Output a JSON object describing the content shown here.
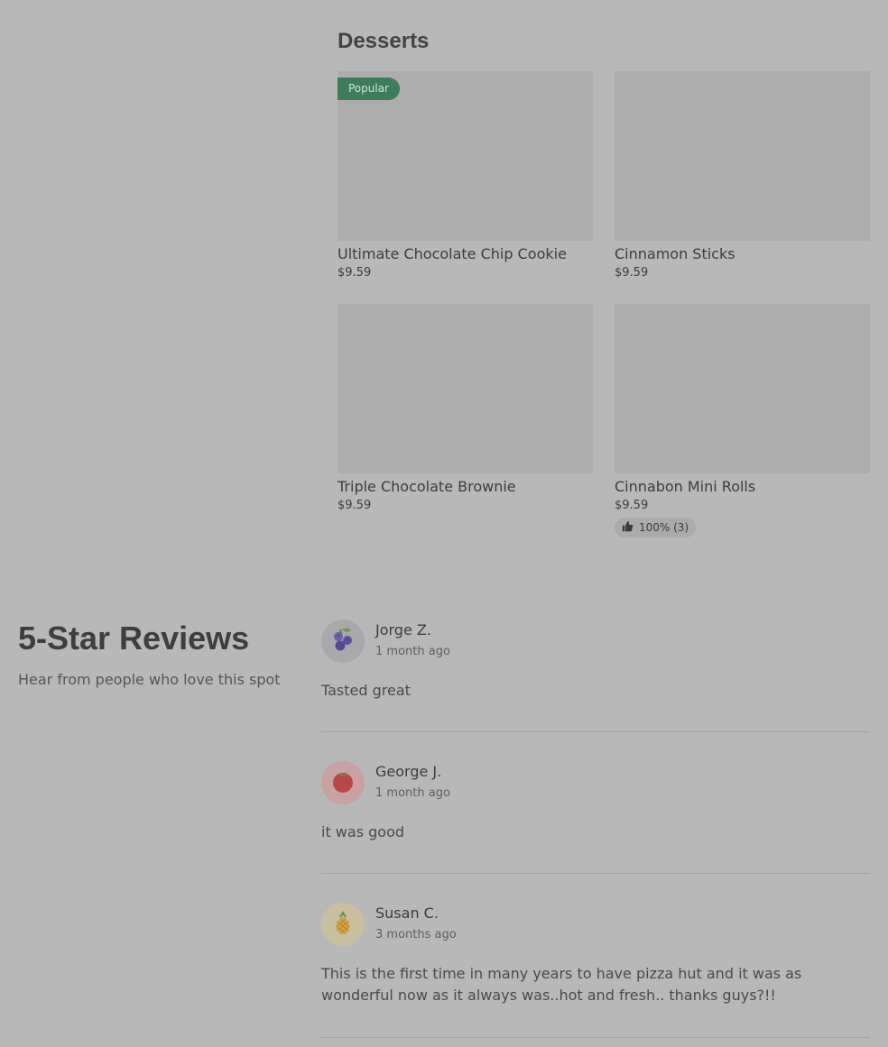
{
  "menu": {
    "section_title": "Desserts",
    "items": [
      {
        "name": "Ultimate Chocolate Chip Cookie",
        "price": "$9.59",
        "badge": "Popular"
      },
      {
        "name": "Cinnamon Sticks",
        "price": "$9.59"
      },
      {
        "name": "Triple Chocolate Brownie",
        "price": "$9.59"
      },
      {
        "name": "Cinnabon Mini Rolls",
        "price": "$9.59",
        "rating": "100% (3)",
        "rating_icon": "thumbs-up-icon"
      }
    ]
  },
  "reviews": {
    "heading": "5-Star Reviews",
    "subheading": "Hear from people who love this spot",
    "items": [
      {
        "author": "Jorge Z.",
        "time": "1 month ago",
        "text": "Tasted great",
        "avatar_icon": "blueberry-icon",
        "avatar_bg": "#a9a9ad"
      },
      {
        "author": "George J.",
        "time": "1 month ago",
        "text": "it was good",
        "avatar_icon": "tomato-icon",
        "avatar_bg": "#c8a2a2"
      },
      {
        "author": "Susan C.",
        "time": "3 months ago",
        "text": "This is the first time in many years to have pizza hut and it was as wonderful now as it always was..hot and fresh.. thanks guys?!!",
        "avatar_icon": "pineapple-icon",
        "avatar_bg": "#c7bf9f"
      }
    ]
  },
  "colors": {
    "page_bg": "#b8b8b8",
    "badge_bg": "#3e7c5b",
    "image_placeholder": "#adadad"
  }
}
